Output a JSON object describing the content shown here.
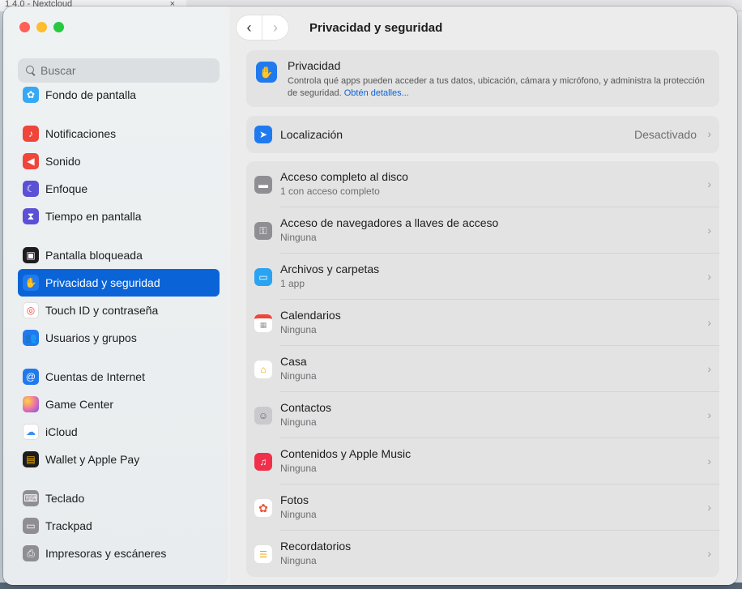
{
  "background": {
    "tab_title": "1.4.0 - Nextcloud",
    "tab_close": "×"
  },
  "sidebar": {
    "search_placeholder": "Buscar",
    "items": [
      {
        "label": "Fondo de pantalla",
        "icon": "wallpaper-icon",
        "color": "#36a8f5"
      },
      {
        "label": "Notificaciones",
        "icon": "bell-icon",
        "color": "#f0453a"
      },
      {
        "label": "Sonido",
        "icon": "speaker-icon",
        "color": "#f0453a"
      },
      {
        "label": "Enfoque",
        "icon": "moon-icon",
        "color": "#5b50d6"
      },
      {
        "label": "Tiempo en pantalla",
        "icon": "hourglass-icon",
        "color": "#5b50d6"
      },
      {
        "label": "Pantalla bloqueada",
        "icon": "lock-icon",
        "color": "#1d1d1f"
      },
      {
        "label": "Privacidad y seguridad",
        "icon": "hand-icon",
        "color": "#1f7af0"
      },
      {
        "label": "Touch ID y contraseña",
        "icon": "fingerprint-icon",
        "color": "#ffffff"
      },
      {
        "label": "Usuarios y grupos",
        "icon": "users-icon",
        "color": "#1f7af0"
      },
      {
        "label": "Cuentas de Internet",
        "icon": "at-icon",
        "color": "#1f7af0"
      },
      {
        "label": "Game Center",
        "icon": "game-center-icon",
        "color": "#e86cae"
      },
      {
        "label": "iCloud",
        "icon": "cloud-icon",
        "color": "#ffffff"
      },
      {
        "label": "Wallet y Apple Pay",
        "icon": "wallet-icon",
        "color": "#1d1d1f"
      },
      {
        "label": "Teclado",
        "icon": "keyboard-icon",
        "color": "#8e8e93"
      },
      {
        "label": "Trackpad",
        "icon": "trackpad-icon",
        "color": "#8e8e93"
      },
      {
        "label": "Impresoras y escáneres",
        "icon": "printer-icon",
        "color": "#8e8e93"
      }
    ]
  },
  "main": {
    "title": "Privacidad y seguridad",
    "back_glyph": "‹",
    "forward_glyph": "›",
    "privacy": {
      "title": "Privacidad",
      "description": "Controla qué apps pueden acceder a tus datos, ubicación, cámara y micrófono, y administra la protección de seguridad.",
      "link": "Obtén detalles..."
    },
    "location": {
      "title": "Localización",
      "value": "Desactivado"
    },
    "rows": [
      {
        "title": "Acceso completo al disco",
        "subtitle": "1 con acceso completo",
        "icon": "disk-icon",
        "color": "#8e8e93"
      },
      {
        "title": "Acceso de navegadores a llaves de acceso",
        "subtitle": "Ninguna",
        "icon": "passkey-icon",
        "color": "#8e8e93"
      },
      {
        "title": "Archivos y carpetas",
        "subtitle": "1 app",
        "icon": "folder-icon",
        "color": "#2aa3f2"
      },
      {
        "title": "Calendarios",
        "subtitle": "Ninguna",
        "icon": "calendar-icon",
        "color": "#ffffff"
      },
      {
        "title": "Casa",
        "subtitle": "Ninguna",
        "icon": "home-icon",
        "color": "#ffffff"
      },
      {
        "title": "Contactos",
        "subtitle": "Ninguna",
        "icon": "contacts-icon",
        "color": "#c9c9ce"
      },
      {
        "title": "Contenidos y Apple Music",
        "subtitle": "Ninguna",
        "icon": "music-icon",
        "color": "#f0304b"
      },
      {
        "title": "Fotos",
        "subtitle": "Ninguna",
        "icon": "photos-icon",
        "color": "#ffffff"
      },
      {
        "title": "Recordatorios",
        "subtitle": "Ninguna",
        "icon": "reminders-icon",
        "color": "#ffffff"
      }
    ]
  }
}
